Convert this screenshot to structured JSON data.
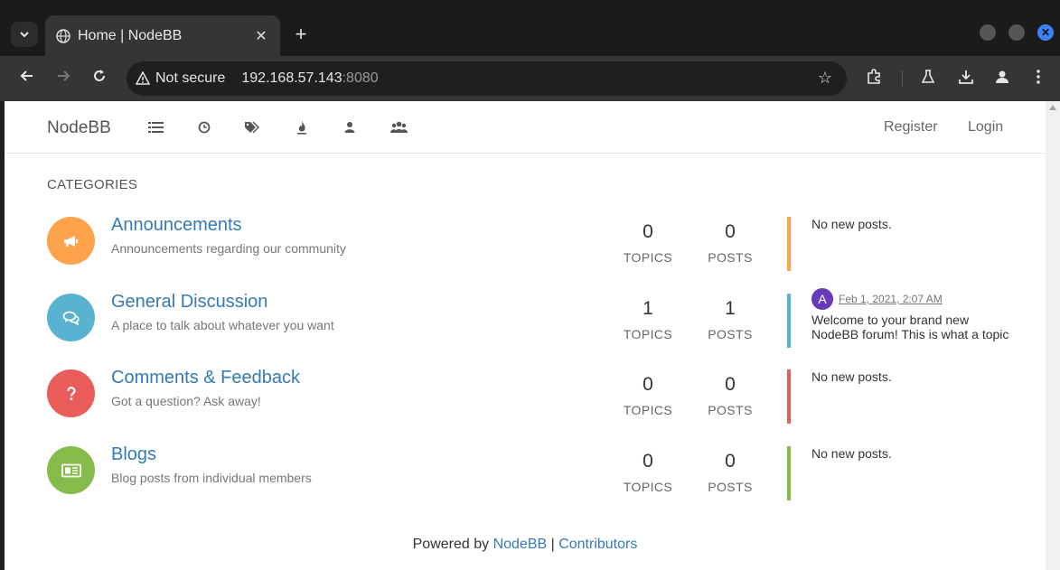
{
  "browser": {
    "tab_title": "Home | NodeBB",
    "new_tab_glyph": "+",
    "close_glyph": "✕",
    "security_label": "Not secure",
    "url_host": "192.168.57.143",
    "url_port": ":8080",
    "accent_color": "#3b82f6"
  },
  "site": {
    "brand": "NodeBB",
    "nav_icons": [
      "categories-list-icon",
      "recent-clock-icon",
      "tags-icon",
      "popular-fire-icon",
      "users-icon",
      "groups-icon"
    ],
    "register_label": "Register",
    "login_label": "Login"
  },
  "main": {
    "section_title": "CATEGORIES",
    "categories": [
      {
        "name": "Announcements",
        "description": "Announcements regarding our community",
        "icon": "bullhorn-icon",
        "color": "#fda34b",
        "topics": "0",
        "topics_label": "TOPICS",
        "posts": "0",
        "posts_label": "POSTS",
        "teaser": "No new posts."
      },
      {
        "name": "General Discussion",
        "description": "A place to talk about whatever you want",
        "icon": "comments-icon",
        "color": "#59b3d0",
        "topics": "1",
        "topics_label": "TOPICS",
        "posts": "1",
        "posts_label": "POSTS",
        "teaser_avatar": "A",
        "teaser_time": "Feb 1, 2021, 2:07 AM",
        "teaser_text": "Welcome to your brand new NodeBB forum! This is what a topic"
      },
      {
        "name": "Comments & Feedback",
        "description": "Got a question? Ask away!",
        "icon": "question-icon",
        "color": "#e95c5a",
        "topics": "0",
        "topics_label": "TOPICS",
        "posts": "0",
        "posts_label": "POSTS",
        "teaser": "No new posts."
      },
      {
        "name": "Blogs",
        "description": "Blog posts from individual members",
        "icon": "newspaper-icon",
        "color": "#86ba4b",
        "topics": "0",
        "topics_label": "TOPICS",
        "posts": "0",
        "posts_label": "POSTS",
        "teaser": "No new posts."
      }
    ]
  },
  "footer": {
    "powered_by": "Powered by ",
    "nodebb_link": "NodeBB",
    "separator": " | ",
    "contributors_link": "Contributors"
  }
}
